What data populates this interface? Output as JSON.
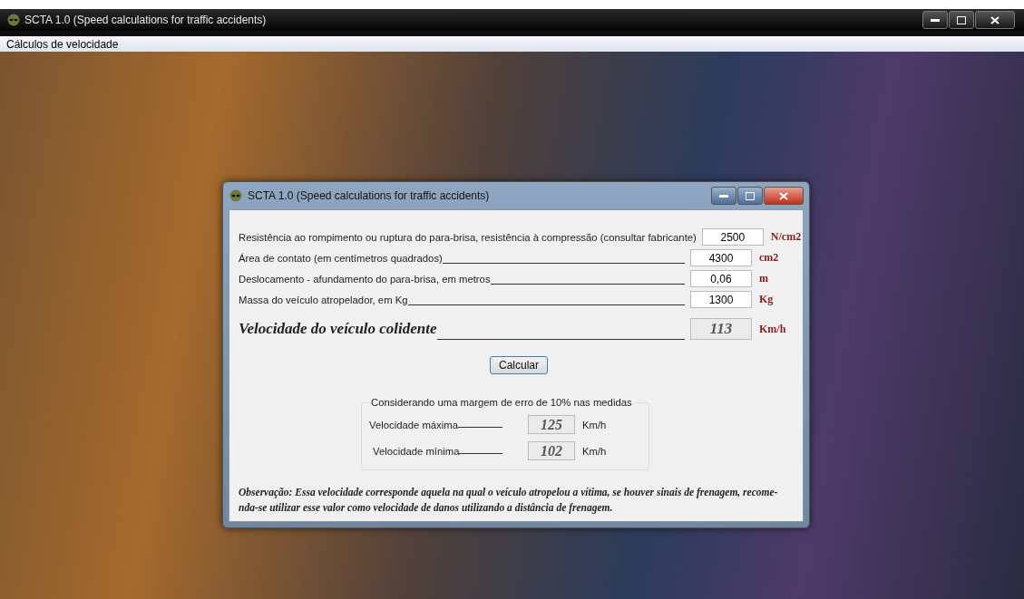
{
  "window": {
    "title": "SCTA 1.0 (Speed calculations for traffic accidents)"
  },
  "menu": [
    "Cálculos de velocidade"
  ],
  "dialog": {
    "title": "SCTA 1.0 (Speed calculations for traffic accidents)",
    "inputs": [
      {
        "label": "Resistência ao rompimento ou ruptura do para-brisa, resistência à compressão (consultar fabricante)",
        "value": "2500",
        "unit": "N/cm2"
      },
      {
        "label": "Área de contato (em centímetros quadrados)",
        "value": "4300",
        "unit": "cm2"
      },
      {
        "label": "Deslocamento - afundamento do para-brisa, em metros",
        "value": "0,06",
        "unit": "m"
      },
      {
        "label": "Massa do veículo atropelador, em Kg",
        "value": "1300",
        "unit": "Kg"
      }
    ],
    "result": {
      "label": "Velocidade do veículo colidente",
      "value": "113",
      "unit": "Km/h"
    },
    "button": "Calcular",
    "margin_group": {
      "title": "Considerando uma margem de erro de 10% nas medidas",
      "rows": [
        {
          "label": "Velocidade máxima",
          "value": "125",
          "unit": "Km/h"
        },
        {
          "label": "Velocidade mínima",
          "value": "102",
          "unit": "Km/h"
        }
      ]
    },
    "note_lines": [
      "Observação: Essa velocidade corresponde aquela na qual o veículo atropelou a vítima, se houver sinais de frenagem, recome-",
      "nda-se utilizar esse valor como velocidade de danos utilizando a distância de frenagem."
    ]
  }
}
